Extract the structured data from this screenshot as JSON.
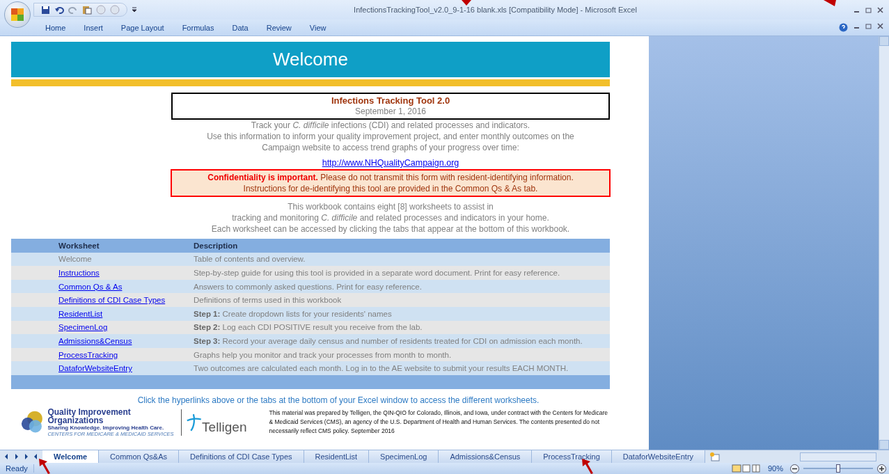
{
  "window": {
    "title": "InfectionsTrackingTool_v2.0_9-1-16 blank.xls  [Compatibility Mode] - Microsoft Excel"
  },
  "ribbon_tabs": [
    {
      "label": "Home",
      "selected": false
    },
    {
      "label": "Insert",
      "selected": false
    },
    {
      "label": "Page Layout",
      "selected": false
    },
    {
      "label": "Formulas",
      "selected": false
    },
    {
      "label": "Data",
      "selected": false
    },
    {
      "label": "Review",
      "selected": false
    },
    {
      "label": "View",
      "selected": false
    }
  ],
  "sheet": {
    "banner": "Welcome",
    "title_box": {
      "title": "Infections Tracking Tool 2.0",
      "date": "September 1, 2016"
    },
    "intro": [
      "Track your *C. difficile* infections (CDI) and related processes and indicators.",
      "Use this information to inform your quality improvement project, and enter monthly outcomes on the",
      "Campaign website to access trend graphs of your progress over time:"
    ],
    "link": "http://www.NHQualityCampaign.org",
    "notice": [
      "**Confidentiality is important.** Please do not transmit this form with resident-identifying information.",
      "Instructions for de-identifying this tool are provided in the Common Qs & As tab."
    ],
    "overview": [
      "This workbook contains eight [8] worksheets to assist in",
      "tracking and monitoring *C. difficile* and related processes and indicators in your home.",
      "Each worksheet can be accessed by clicking the tabs that appear at the bottom of this workbook."
    ],
    "table": {
      "columns": [
        "Worksheet",
        "Description"
      ],
      "rows": [
        {
          "worksheet": "Welcome",
          "link": false,
          "description": "Table of contents and overview."
        },
        {
          "worksheet": "Instructions",
          "link": true,
          "description": "Step-by-step guide for using this tool is provided in a separate word document. Print for easy reference."
        },
        {
          "worksheet": "Common Qs & As",
          "link": true,
          "description": "Answers to commonly asked questions. Print for easy reference."
        },
        {
          "worksheet": "Definitions of CDI Case Types",
          "link": true,
          "description": "Definitions of terms used in this workbook"
        },
        {
          "worksheet": "ResidentList",
          "link": true,
          "description": "**Step 1:** Create dropdown lists for your residents' names"
        },
        {
          "worksheet": "SpecimenLog",
          "link": true,
          "description": "**Step 2:**  Log each  CDI POSITIVE result you receive from the lab."
        },
        {
          "worksheet": "Admissions&Census",
          "link": true,
          "description": "**Step 3:**  Record your average daily census and number of residents treated for CDI on admission each month."
        },
        {
          "worksheet": "ProcessTracking",
          "link": true,
          "description": "Graphs help you monitor and track your processes from month to month."
        },
        {
          "worksheet": "DataforWebsiteEntry",
          "link": true,
          "description": "Two outcomes are calculated each month. Log in to the AE website to submit your results EACH MONTH."
        }
      ]
    },
    "hint": "Click the hyperlinks above or the tabs at the bottom of your Excel window to access the different worksheets.",
    "qio_logo": {
      "name_line1": "Quality Improvement",
      "name_line2": "Organizations",
      "tagline": "Sharing Knowledge. Improving Health Care.",
      "subline": "CENTERS FOR MEDICARE & MEDICAID SERVICES"
    },
    "telligen_logo": "Telligen",
    "disclaimer": "This material was prepared by Telligen, the QIN-QIO for Colorado, Illinois, and Iowa, under contract with the Centers for Medicare & Medicaid Services (CMS), an agency of the U.S. Department of Health and Human Services. The contents presented do not necessarily reflect CMS policy. September 2016"
  },
  "sheet_tabs": [
    {
      "label": "Welcome",
      "selected": true
    },
    {
      "label": "Common Qs&As",
      "selected": false
    },
    {
      "label": "Definitions of CDI Case Types",
      "selected": false
    },
    {
      "label": "ResidentList",
      "selected": false
    },
    {
      "label": "SpecimenLog",
      "selected": false
    },
    {
      "label": "Admissions&Census",
      "selected": false
    },
    {
      "label": "ProcessTracking",
      "selected": false
    },
    {
      "label": "DataforWebsiteEntry",
      "selected": false
    }
  ],
  "status_bar": {
    "status": "Ready",
    "zoom": "90%",
    "zoom_level": {
      "level": 0.5
    }
  }
}
